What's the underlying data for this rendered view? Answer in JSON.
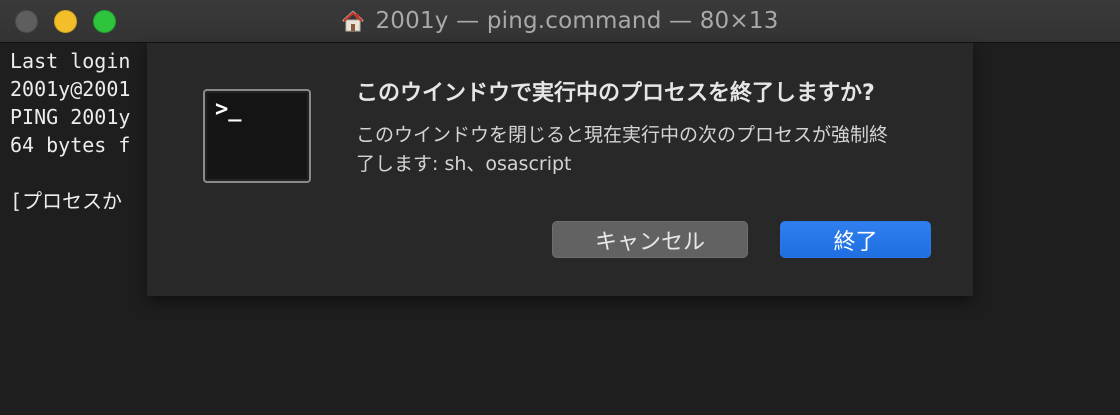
{
  "window": {
    "title": "2001y — ping.command — 80×13",
    "title_icon": "home-icon"
  },
  "terminal": {
    "lines": [
      "Last login",
      "2001y@2001",
      "PING 2001y",
      "64 bytes f",
      "",
      "[プロセスか"
    ]
  },
  "dialog": {
    "icon": "terminal-app-icon",
    "icon_prompt": ">_",
    "heading": "このウインドウで実行中のプロセスを終了しますか?",
    "body_line1": "このウインドウを閉じると現在実行中の次のプロセスが強制終",
    "body_line2": "了します: sh、osascript",
    "cancel_label": "キャンセル",
    "confirm_label": "終了"
  },
  "colors": {
    "close_button": "#5e5e5e",
    "minimize_button": "#f2bf2b",
    "zoom_button": "#2fc43d",
    "primary_button": "#2a77e8",
    "sheet_background": "#282828",
    "terminal_background": "#1e1e1e"
  }
}
